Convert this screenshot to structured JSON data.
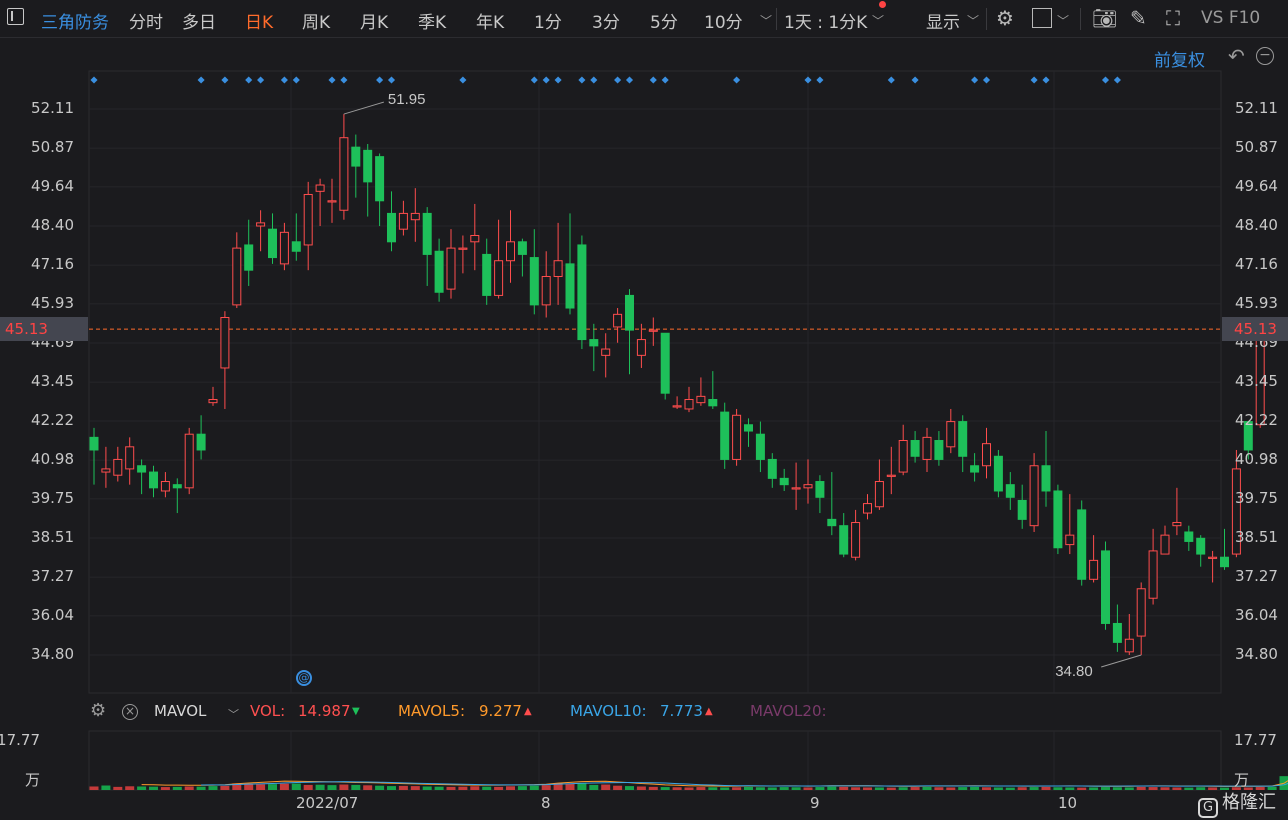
{
  "toolbar": {
    "stock_name": "三角防务",
    "tabs": [
      "分时",
      "多日",
      "日K",
      "周K",
      "月K",
      "季K",
      "年K",
      "1分",
      "3分",
      "5分",
      "10分"
    ],
    "active_tab": "日K",
    "range_select": "1天 : 1分K",
    "display_label": "显示",
    "vsf10": "VS F10"
  },
  "adjust_label": "前复权",
  "current_price": "45.13",
  "indicator": {
    "name": "MAVOL",
    "vol_label": "VOL:",
    "vol_value": "14.987",
    "vol_arrow": "▼",
    "mavol5_label": "MAVOL5:",
    "mavol5_value": "9.277",
    "mavol5_arrow": "▲",
    "mavol10_label": "MAVOL10:",
    "mavol10_value": "7.773",
    "mavol10_arrow": "▲",
    "mavol20_label": "MAVOL20:"
  },
  "volume_axis": {
    "max": "17.77",
    "unit": "万"
  },
  "date_labels": [
    "2022/07",
    "8",
    "9",
    "10"
  ],
  "price_annotations": {
    "high": "51.95",
    "low": "34.80"
  },
  "logo_text": "格隆汇",
  "colors": {
    "up": "#ff4d4d",
    "down": "#1ec05a",
    "accent": "#3a8fe0",
    "active": "#ff6b2b",
    "dashed": "#ff6b2b"
  },
  "chart_data": {
    "type": "candlestick",
    "y_ticks": [
      "52.11",
      "50.87",
      "49.64",
      "48.40",
      "47.16",
      "45.93",
      "44.69",
      "43.45",
      "42.22",
      "40.98",
      "39.75",
      "38.51",
      "37.27",
      "36.04",
      "34.80"
    ],
    "ylim": [
      34.8,
      52.11
    ],
    "x_ticks": [
      "2022/07",
      "8",
      "9",
      "10"
    ],
    "candles": [
      {
        "o": 41.7,
        "c": 41.3,
        "h": 42.0,
        "l": 40.2
      },
      {
        "o": 40.6,
        "c": 40.7,
        "h": 41.4,
        "l": 40.1
      },
      {
        "o": 40.5,
        "c": 41.0,
        "h": 41.4,
        "l": 40.3
      },
      {
        "o": 40.7,
        "c": 41.4,
        "h": 41.7,
        "l": 40.2
      },
      {
        "o": 40.8,
        "c": 40.6,
        "h": 41.0,
        "l": 39.9
      },
      {
        "o": 40.6,
        "c": 40.1,
        "h": 40.8,
        "l": 39.8
      },
      {
        "o": 40.0,
        "c": 40.3,
        "h": 40.6,
        "l": 39.8
      },
      {
        "o": 40.2,
        "c": 40.1,
        "h": 40.4,
        "l": 39.3
      },
      {
        "o": 40.1,
        "c": 41.8,
        "h": 42.0,
        "l": 39.9
      },
      {
        "o": 41.8,
        "c": 41.3,
        "h": 42.4,
        "l": 41.0
      },
      {
        "o": 42.8,
        "c": 42.9,
        "h": 43.3,
        "l": 42.7
      },
      {
        "o": 43.9,
        "c": 45.5,
        "h": 45.7,
        "l": 42.6
      },
      {
        "o": 45.9,
        "c": 47.7,
        "h": 48.2,
        "l": 45.8
      },
      {
        "o": 47.8,
        "c": 47.0,
        "h": 48.6,
        "l": 46.5
      },
      {
        "o": 48.4,
        "c": 48.5,
        "h": 48.9,
        "l": 47.6
      },
      {
        "o": 48.3,
        "c": 47.4,
        "h": 48.8,
        "l": 47.2
      },
      {
        "o": 47.2,
        "c": 48.2,
        "h": 48.5,
        "l": 47.0
      },
      {
        "o": 47.9,
        "c": 47.6,
        "h": 48.8,
        "l": 47.3
      },
      {
        "o": 47.8,
        "c": 49.4,
        "h": 49.8,
        "l": 47.0
      },
      {
        "o": 49.5,
        "c": 49.7,
        "h": 49.9,
        "l": 48.4
      },
      {
        "o": 49.2,
        "c": 49.2,
        "h": 49.9,
        "l": 48.5
      },
      {
        "o": 48.9,
        "c": 51.2,
        "h": 51.95,
        "l": 48.6
      },
      {
        "o": 50.9,
        "c": 50.3,
        "h": 51.3,
        "l": 49.3
      },
      {
        "o": 50.8,
        "c": 49.8,
        "h": 51.0,
        "l": 48.7
      },
      {
        "o": 50.6,
        "c": 49.2,
        "h": 50.7,
        "l": 48.4
      },
      {
        "o": 48.8,
        "c": 47.9,
        "h": 49.5,
        "l": 47.6
      },
      {
        "o": 48.3,
        "c": 48.8,
        "h": 49.2,
        "l": 48.1
      },
      {
        "o": 48.6,
        "c": 48.8,
        "h": 49.6,
        "l": 47.9
      },
      {
        "o": 48.8,
        "c": 47.5,
        "h": 49.0,
        "l": 46.5
      },
      {
        "o": 47.6,
        "c": 46.3,
        "h": 48.0,
        "l": 46.0
      },
      {
        "o": 46.4,
        "c": 47.7,
        "h": 48.3,
        "l": 46.1
      },
      {
        "o": 47.7,
        "c": 47.7,
        "h": 48.1,
        "l": 46.9
      },
      {
        "o": 47.9,
        "c": 48.1,
        "h": 49.1,
        "l": 47.0
      },
      {
        "o": 47.5,
        "c": 46.2,
        "h": 48.0,
        "l": 45.9
      },
      {
        "o": 46.2,
        "c": 47.3,
        "h": 48.6,
        "l": 46.1
      },
      {
        "o": 47.3,
        "c": 47.9,
        "h": 48.9,
        "l": 46.6
      },
      {
        "o": 47.9,
        "c": 47.5,
        "h": 48.0,
        "l": 46.8
      },
      {
        "o": 47.4,
        "c": 45.9,
        "h": 48.3,
        "l": 45.6
      },
      {
        "o": 45.9,
        "c": 46.8,
        "h": 47.6,
        "l": 45.5
      },
      {
        "o": 46.8,
        "c": 47.3,
        "h": 48.5,
        "l": 45.9
      },
      {
        "o": 47.2,
        "c": 45.8,
        "h": 48.8,
        "l": 45.6
      },
      {
        "o": 47.8,
        "c": 44.8,
        "h": 48.1,
        "l": 44.5
      },
      {
        "o": 44.8,
        "c": 44.6,
        "h": 45.3,
        "l": 43.8
      },
      {
        "o": 44.3,
        "c": 44.5,
        "h": 45.0,
        "l": 43.6
      },
      {
        "o": 45.2,
        "c": 45.6,
        "h": 45.8,
        "l": 44.7
      },
      {
        "o": 46.2,
        "c": 45.1,
        "h": 46.4,
        "l": 43.7
      },
      {
        "o": 44.3,
        "c": 44.8,
        "h": 45.3,
        "l": 43.9
      },
      {
        "o": 45.1,
        "c": 45.1,
        "h": 45.5,
        "l": 44.6
      },
      {
        "o": 45.0,
        "c": 43.1,
        "h": 45.0,
        "l": 42.9
      },
      {
        "o": 42.7,
        "c": 42.7,
        "h": 43.0,
        "l": 42.6
      },
      {
        "o": 42.6,
        "c": 42.9,
        "h": 43.3,
        "l": 42.5
      },
      {
        "o": 42.8,
        "c": 43.0,
        "h": 43.6,
        "l": 42.7
      },
      {
        "o": 42.9,
        "c": 42.7,
        "h": 43.8,
        "l": 42.6
      },
      {
        "o": 42.5,
        "c": 41.0,
        "h": 42.8,
        "l": 40.7
      },
      {
        "o": 41.0,
        "c": 42.4,
        "h": 42.6,
        "l": 40.8
      },
      {
        "o": 42.1,
        "c": 41.9,
        "h": 42.3,
        "l": 41.4
      },
      {
        "o": 41.8,
        "c": 41.0,
        "h": 42.2,
        "l": 40.6
      },
      {
        "o": 41.0,
        "c": 40.4,
        "h": 41.2,
        "l": 40.1
      },
      {
        "o": 40.4,
        "c": 40.2,
        "h": 40.7,
        "l": 40.0
      },
      {
        "o": 40.1,
        "c": 40.1,
        "h": 40.9,
        "l": 39.4
      },
      {
        "o": 40.1,
        "c": 40.2,
        "h": 41.0,
        "l": 39.6
      },
      {
        "o": 40.3,
        "c": 39.8,
        "h": 40.5,
        "l": 39.3
      },
      {
        "o": 39.1,
        "c": 38.9,
        "h": 40.6,
        "l": 38.6
      },
      {
        "o": 38.9,
        "c": 38.0,
        "h": 39.3,
        "l": 37.9
      },
      {
        "o": 37.9,
        "c": 39.0,
        "h": 39.4,
        "l": 37.8
      },
      {
        "o": 39.3,
        "c": 39.6,
        "h": 39.9,
        "l": 39.1
      },
      {
        "o": 39.5,
        "c": 40.3,
        "h": 41.0,
        "l": 39.4
      },
      {
        "o": 40.5,
        "c": 40.5,
        "h": 41.4,
        "l": 39.9
      },
      {
        "o": 40.6,
        "c": 41.6,
        "h": 42.1,
        "l": 40.5
      },
      {
        "o": 41.6,
        "c": 41.1,
        "h": 41.9,
        "l": 40.9
      },
      {
        "o": 41.0,
        "c": 41.7,
        "h": 42.0,
        "l": 40.6
      },
      {
        "o": 41.6,
        "c": 41.0,
        "h": 41.9,
        "l": 40.8
      },
      {
        "o": 41.4,
        "c": 42.2,
        "h": 42.6,
        "l": 41.2
      },
      {
        "o": 42.2,
        "c": 41.1,
        "h": 42.4,
        "l": 40.6
      },
      {
        "o": 40.8,
        "c": 40.6,
        "h": 41.2,
        "l": 40.3
      },
      {
        "o": 40.8,
        "c": 41.5,
        "h": 42.0,
        "l": 40.4
      },
      {
        "o": 41.1,
        "c": 40.0,
        "h": 41.3,
        "l": 39.8
      },
      {
        "o": 40.2,
        "c": 39.8,
        "h": 40.6,
        "l": 39.4
      },
      {
        "o": 39.7,
        "c": 39.1,
        "h": 40.2,
        "l": 38.8
      },
      {
        "o": 38.9,
        "c": 40.8,
        "h": 41.2,
        "l": 38.7
      },
      {
        "o": 40.8,
        "c": 40.0,
        "h": 41.9,
        "l": 39.5
      },
      {
        "o": 40.0,
        "c": 38.2,
        "h": 40.2,
        "l": 38.0
      },
      {
        "o": 38.3,
        "c": 38.6,
        "h": 39.9,
        "l": 38.0
      },
      {
        "o": 39.4,
        "c": 37.2,
        "h": 39.7,
        "l": 37.0
      },
      {
        "o": 37.2,
        "c": 37.8,
        "h": 38.6,
        "l": 37.1
      },
      {
        "o": 38.1,
        "c": 35.8,
        "h": 38.4,
        "l": 35.6
      },
      {
        "o": 35.8,
        "c": 35.2,
        "h": 36.4,
        "l": 34.9
      },
      {
        "o": 34.9,
        "c": 35.3,
        "h": 36.1,
        "l": 34.8
      },
      {
        "o": 35.4,
        "c": 36.9,
        "h": 37.1,
        "l": 34.8
      },
      {
        "o": 36.6,
        "c": 38.1,
        "h": 38.8,
        "l": 36.4
      },
      {
        "o": 38.0,
        "c": 38.6,
        "h": 38.9,
        "l": 38.0
      },
      {
        "o": 38.9,
        "c": 39.0,
        "h": 40.1,
        "l": 38.6
      },
      {
        "o": 38.7,
        "c": 38.4,
        "h": 38.9,
        "l": 38.1
      },
      {
        "o": 38.5,
        "c": 38.0,
        "h": 38.6,
        "l": 37.6
      },
      {
        "o": 37.9,
        "c": 37.9,
        "h": 38.1,
        "l": 37.1
      },
      {
        "o": 37.9,
        "c": 37.6,
        "h": 38.8,
        "l": 37.5
      },
      {
        "o": 38.0,
        "c": 40.7,
        "h": 41.3,
        "l": 37.9
      },
      {
        "o": 42.2,
        "c": 41.3,
        "h": 42.2,
        "l": 41.0
      },
      {
        "o": 42.1,
        "c": 45.13,
        "h": 45.13,
        "l": 42.0
      }
    ],
    "signal_markers": [
      0,
      9,
      11,
      13,
      14,
      16,
      17,
      20,
      21,
      24,
      25,
      31,
      37,
      38,
      39,
      41,
      42,
      44,
      45,
      47,
      48,
      54,
      60,
      61,
      67,
      69,
      74,
      75,
      79,
      80,
      85,
      86
    ],
    "volumes": [
      1.8,
      2.3,
      1.6,
      1.9,
      1.8,
      1.7,
      1.5,
      1.6,
      1.8,
      1.7,
      2.0,
      2.1,
      3.4,
      3.1,
      2.9,
      3.0,
      3.2,
      3.3,
      2.6,
      2.7,
      2.5,
      2.8,
      2.6,
      2.4,
      2.2,
      2.0,
      2.1,
      2.0,
      1.8,
      1.7,
      1.6,
      1.7,
      1.9,
      1.7,
      1.6,
      1.9,
      2.0,
      2.2,
      2.5,
      3.6,
      3.1,
      3.3,
      2.6,
      2.8,
      2.2,
      2.0,
      1.8,
      1.6,
      1.5,
      1.4,
      1.3,
      1.5,
      1.4,
      1.3,
      1.4,
      1.6,
      1.4,
      1.3,
      1.5,
      1.4,
      1.3,
      1.5,
      1.7,
      1.6,
      1.4,
      1.3,
      1.3,
      1.2,
      1.4,
      1.5,
      1.6,
      1.4,
      1.3,
      1.5,
      1.6,
      1.4,
      1.3,
      1.2,
      1.4,
      1.5,
      1.6,
      1.4,
      1.3,
      1.2,
      1.3,
      1.5,
      1.4,
      1.3,
      1.6,
      1.5,
      1.4,
      1.3,
      1.2,
      1.4,
      1.3,
      1.2,
      1.4,
      1.3,
      1.5,
      1.6,
      6.1,
      14.987
    ],
    "vol_up": [
      0,
      2,
      3,
      6,
      8,
      11,
      12,
      13,
      14,
      16,
      18,
      21,
      23,
      26,
      27,
      30,
      31,
      32,
      34,
      35,
      38,
      39,
      40,
      43,
      44,
      46,
      47,
      49,
      50,
      51,
      54,
      60,
      63,
      64,
      65,
      67,
      69,
      71,
      72,
      75,
      78,
      80,
      83,
      88,
      89,
      90,
      91,
      94,
      96,
      97,
      98
    ],
    "volume_ylim": [
      0,
      17.77
    ]
  }
}
